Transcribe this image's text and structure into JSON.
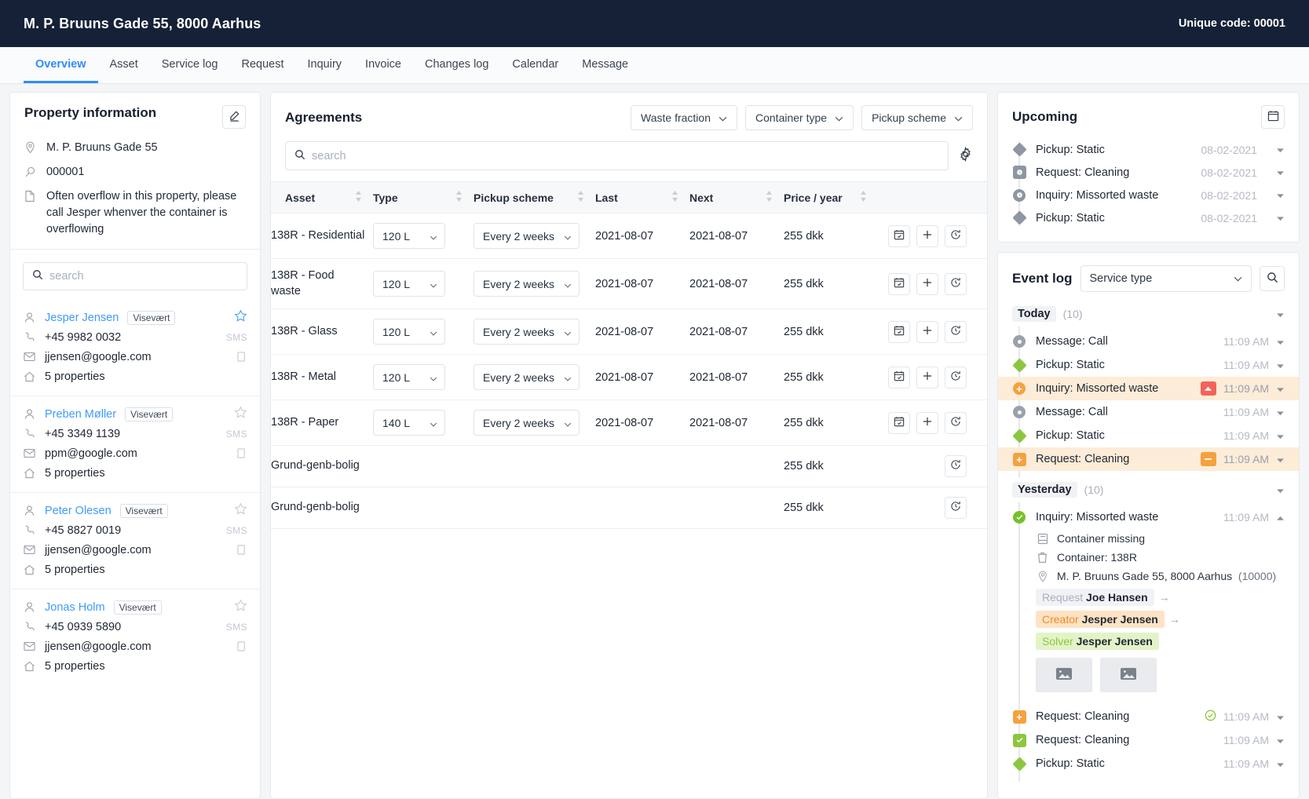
{
  "titlebar": {
    "address": "M. P. Bruuns Gade 55, 8000 Aarhus",
    "unique_code": "Unique code: 00001"
  },
  "tabs": [
    {
      "label": "Overview",
      "active": true
    },
    {
      "label": "Asset",
      "active": false
    },
    {
      "label": "Service log",
      "active": false
    },
    {
      "label": "Request",
      "active": false
    },
    {
      "label": "Inquiry",
      "active": false
    },
    {
      "label": "Invoice",
      "active": false
    },
    {
      "label": "Changes log",
      "active": false
    },
    {
      "label": "Calendar",
      "active": false
    },
    {
      "label": "Message",
      "active": false
    }
  ],
  "property": {
    "title": "Property information",
    "edit_icon": "pencil-icon",
    "address": "M. P. Bruuns Gade 55",
    "id": "000001",
    "note": "Often overflow in this property, please call Jesper whenver the container is overflowing",
    "search_placeholder": "search",
    "search_value": "",
    "sms_label": "SMS",
    "contacts": [
      {
        "name": "Jesper Jensen",
        "role": "Visevært",
        "phone": "+45 9982 0032",
        "email": "jjensen@google.com",
        "properties": "5 properties",
        "starred": true
      },
      {
        "name": "Preben Møller",
        "role": "Visevært",
        "phone": "+45 3349 1139",
        "email": "ppm@google.com",
        "properties": "5 properties",
        "starred": false
      },
      {
        "name": "Peter Olesen",
        "role": "Visevært",
        "phone": "+45 8827 0019",
        "email": "jjensen@google.com",
        "properties": "5 properties",
        "starred": false
      },
      {
        "name": "Jonas Holm",
        "role": "Visevært",
        "phone": "+45 0939 5890",
        "email": "jjensen@google.com",
        "properties": "5 properties",
        "starred": false
      }
    ]
  },
  "agreements": {
    "title": "Agreements",
    "filters": [
      {
        "label": "Waste fraction"
      },
      {
        "label": "Container type"
      },
      {
        "label": "Pickup scheme"
      }
    ],
    "search_placeholder": "search",
    "search_value": "",
    "settings_icon": "gear-icon",
    "columns": [
      "Asset",
      "Type",
      "Pickup scheme",
      "Last",
      "Next",
      "Price / year"
    ],
    "rows": [
      {
        "asset": "138R - Residential",
        "type": "120 L",
        "scheme": "Every 2 weeks",
        "last": "2021-08-07",
        "next": "2021-08-07",
        "price": "255 dkk",
        "has_selects": true,
        "actions": [
          "calendar-check-icon",
          "plus-icon",
          "history-icon"
        ]
      },
      {
        "asset": "138R - Food waste",
        "type": "120 L",
        "scheme": "Every 2 weeks",
        "last": "2021-08-07",
        "next": "2021-08-07",
        "price": "255 dkk",
        "has_selects": true,
        "actions": [
          "calendar-check-icon",
          "plus-icon",
          "history-icon"
        ]
      },
      {
        "asset": "138R - Glass",
        "type": "120 L",
        "scheme": "Every 2 weeks",
        "last": "2021-08-07",
        "next": "2021-08-07",
        "price": "255 dkk",
        "has_selects": true,
        "actions": [
          "calendar-check-icon",
          "plus-icon",
          "history-icon"
        ]
      },
      {
        "asset": "138R - Metal",
        "type": "120 L",
        "scheme": "Every 2 weeks",
        "last": "2021-08-07",
        "next": "2021-08-07",
        "price": "255 dkk",
        "has_selects": true,
        "actions": [
          "calendar-check-icon",
          "plus-icon",
          "history-icon"
        ]
      },
      {
        "asset": "138R - Paper",
        "type": "140 L",
        "scheme": "Every 2 weeks",
        "last": "2021-08-07",
        "next": "2021-08-07",
        "price": "255 dkk",
        "has_selects": true,
        "actions": [
          "calendar-check-icon",
          "plus-icon",
          "history-icon"
        ]
      },
      {
        "asset": "Grund-genb-bolig",
        "type": "",
        "scheme": "",
        "last": "",
        "next": "",
        "price": "255 dkk",
        "has_selects": false,
        "actions": [
          "history-icon"
        ]
      },
      {
        "asset": "Grund-genb-bolig",
        "type": "",
        "scheme": "",
        "last": "",
        "next": "",
        "price": "255 dkk",
        "has_selects": false,
        "actions": [
          "history-icon"
        ]
      }
    ]
  },
  "upcoming": {
    "title": "Upcoming",
    "calendar_icon": "calendar-icon",
    "items": [
      {
        "label": "Pickup: Static",
        "date": "08-02-2021",
        "marker": "diamond-grey"
      },
      {
        "label": "Request: Cleaning",
        "date": "08-02-2021",
        "marker": "square-grey"
      },
      {
        "label": "Inquiry: Missorted waste",
        "date": "08-02-2021",
        "marker": "circle-grey"
      },
      {
        "label": "Pickup: Static",
        "date": "08-02-2021",
        "marker": "diamond-grey"
      }
    ]
  },
  "event_log": {
    "title": "Event log",
    "service_type_label": "Service type",
    "search_icon": "search-icon",
    "groups": [
      {
        "name": "Today",
        "count": "(10)",
        "events": [
          {
            "label": "Message: Call",
            "time": "11:09 AM",
            "marker": "circle-ring",
            "highlight": false,
            "priority": null
          },
          {
            "label": "Pickup: Static",
            "time": "11:09 AM",
            "marker": "diamond-green",
            "highlight": false,
            "priority": null
          },
          {
            "label": "Inquiry: Missorted waste",
            "time": "11:09 AM",
            "marker": "circle-orange-plus",
            "highlight": true,
            "priority": "high"
          },
          {
            "label": "Message: Call",
            "time": "11:09 AM",
            "marker": "circle-ring",
            "highlight": false,
            "priority": null
          },
          {
            "label": "Pickup: Static",
            "time": "11:09 AM",
            "marker": "diamond-green",
            "highlight": false,
            "priority": null
          },
          {
            "label": "Request: Cleaning",
            "time": "11:09 AM",
            "marker": "square-orange-plus",
            "highlight": true,
            "priority": "medium"
          }
        ]
      },
      {
        "name": "Yesterday",
        "count": "(10)",
        "events": [
          {
            "label": "Inquiry: Missorted waste",
            "time": "11:09 AM",
            "marker": "circle-green-check",
            "highlight": false,
            "priority": null,
            "expanded": true,
            "detail": {
              "subject": "Container missing",
              "container": "Container: 138R",
              "location": "M. P. Bruuns Gade 55, 8000 Aarhus",
              "location_code": "(10000)",
              "chips": [
                {
                  "style": "grey",
                  "key": "Request",
                  "value": "Joe Hansen"
                },
                {
                  "style": "orange",
                  "key": "Creator",
                  "value": "Jesper Jensen"
                },
                {
                  "style": "green",
                  "key": "Solver",
                  "value": "Jesper Jensen"
                }
              ],
              "thumbnails": [
                "image-placeholder-icon",
                "image-placeholder-icon"
              ]
            }
          },
          {
            "label": "Request: Cleaning",
            "time": "11:09 AM",
            "marker": "square-orange-plus",
            "highlight": false,
            "priority": null,
            "status_icon": "check-circle-icon"
          },
          {
            "label": "Request: Cleaning",
            "time": "11:09 AM",
            "marker": "square-green-check",
            "highlight": false,
            "priority": null
          },
          {
            "label": "Pickup: Static",
            "time": "11:09 AM",
            "marker": "diamond-green",
            "highlight": false,
            "priority": null
          }
        ]
      }
    ]
  },
  "colors": {
    "brand_dark": "#152136",
    "accent_blue": "#2f8bfd",
    "green": "#8cc63f",
    "orange": "#f5a13f",
    "red": "#f2645a",
    "highlight_row": "#fdecd8"
  }
}
